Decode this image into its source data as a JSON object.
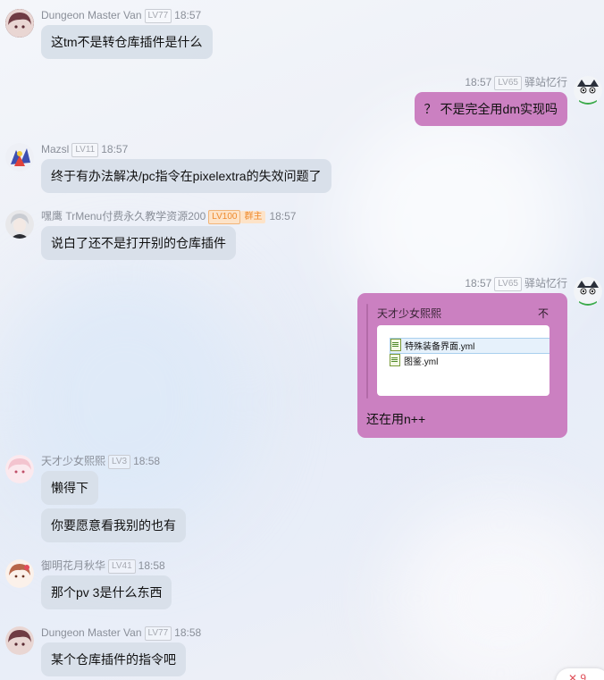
{
  "messages": [
    {
      "id": "m1",
      "name": "Dungeon Master Van",
      "level": "LV77",
      "time": "18:57",
      "bubbles": [
        "这tm不是转仓库插件是什么"
      ]
    },
    {
      "id": "m2",
      "self": true,
      "name": "驿站忆行",
      "level": "LV65",
      "time": "18:57",
      "bubbles": [
        "？ 不是完全用dm实现吗"
      ]
    },
    {
      "id": "m3",
      "name": "Mazsl",
      "level": "LV11",
      "time": "18:57",
      "bubbles": [
        "终于有办法解决/pc指令在pixelextra的失效问题了"
      ]
    },
    {
      "id": "m4",
      "name": "嘿鹰 TrMenu付费永久教学资源200",
      "level": "LV100",
      "role": "群主",
      "time": "18:57",
      "bubbles": [
        "说白了还不是打开别的仓库插件"
      ]
    },
    {
      "id": "m5",
      "self": true,
      "name": "驿站忆行",
      "level": "LV65",
      "time": "18:57",
      "quote": {
        "author": "天才少女熙熙",
        "close": "不",
        "files": [
          "特殊装备界面.yml",
          "图鉴.yml"
        ],
        "reply": "还在用n++"
      }
    },
    {
      "id": "m6",
      "name": "天才少女熙熙",
      "level": "LV3",
      "time": "18:58",
      "bubbles": [
        "懒得下",
        "你要愿意看我别的也有"
      ]
    },
    {
      "id": "m7",
      "name": "御明花月秋华",
      "level": "LV41",
      "time": "18:58",
      "bubbles": [
        "那个pv 3是什么东西"
      ]
    },
    {
      "id": "m8",
      "name": "Dungeon Master Van",
      "level": "LV77",
      "time": "18:58",
      "bubbles": [
        "某个仓库插件的指令吧"
      ]
    }
  ],
  "corner_badge": "✕ 9",
  "colors": {
    "self_bubble": "#cb80c1",
    "other_bubble": "#d7dee8",
    "owner_badge_text": "#ee8a2d"
  }
}
